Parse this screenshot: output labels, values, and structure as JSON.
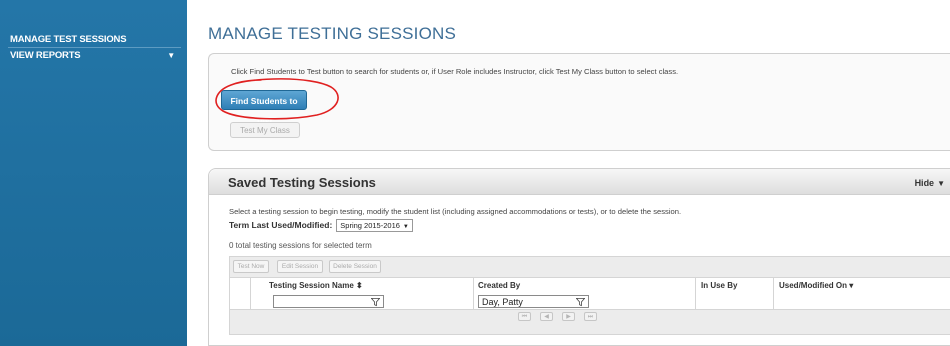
{
  "sidebar": {
    "items": [
      {
        "label": "MANAGE TEST SESSIONS"
      },
      {
        "label": "VIEW REPORTS",
        "icon": "caret-down-icon"
      }
    ],
    "color": "#1f6e9e"
  },
  "page": {
    "title": "MANAGE TESTING SESSIONS"
  },
  "find_panel": {
    "instructions": "Click Find Students to Test button to search for students or, if User Role includes Instructor, click Test My Class button to select class.",
    "find_students_label": "Find Students to Test",
    "test_my_class_label": "Test My Class"
  },
  "saved_panel": {
    "title": "Saved Testing Sessions",
    "hide_label": "Hide",
    "instructions": "Select a testing session to begin testing, modify the student list (including assigned accommodations or tests), or to delete the session.",
    "term_label": "Term Last Used/Modified:",
    "term_value": "Spring 2015-2016",
    "total_text": "0 total testing sessions for selected term",
    "toolbar": {
      "test_now": "Test Now",
      "edit_session": "Edit Session",
      "delete_session": "Delete Session"
    },
    "columns": [
      {
        "label": "Testing Session Name",
        "sort": "sortable"
      },
      {
        "label": "Created By"
      },
      {
        "label": "In Use By"
      },
      {
        "label": "Used/Modified On",
        "sort": "descending"
      }
    ],
    "filters": {
      "session_name": "",
      "created_by": "Day, Patty"
    }
  },
  "colors": {
    "accent": "#2f7fb6",
    "title": "#3f6f97",
    "annotation": "#e02020"
  }
}
